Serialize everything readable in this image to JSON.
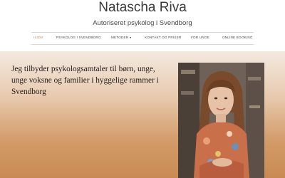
{
  "site": {
    "title": "Natascha Riva",
    "subtitle": "Autoriseret psykolog i Svendborg"
  },
  "nav": {
    "items": [
      {
        "label": "HJEM",
        "active": true
      },
      {
        "label": "PSYKOLOG I SVENDBORG",
        "active": false
      },
      {
        "label": "METODER",
        "active": false,
        "has_dropdown": true
      },
      {
        "label": "KONTAKT OG PRISER",
        "active": false
      },
      {
        "label": "FOR UNGE",
        "active": false
      },
      {
        "label": "ONLINE BOOKING",
        "active": false
      }
    ]
  },
  "hero": {
    "tagline": "Jeg tilbyder psykologsamtaler til børn, unge, unge voksne og familier i hyggelige rammer i Svendborg",
    "photo_icon": "portrait-photo"
  },
  "colors": {
    "accent": "#c9905a",
    "hero_top": "#f3e9df",
    "hero_bottom": "#c98a52"
  }
}
